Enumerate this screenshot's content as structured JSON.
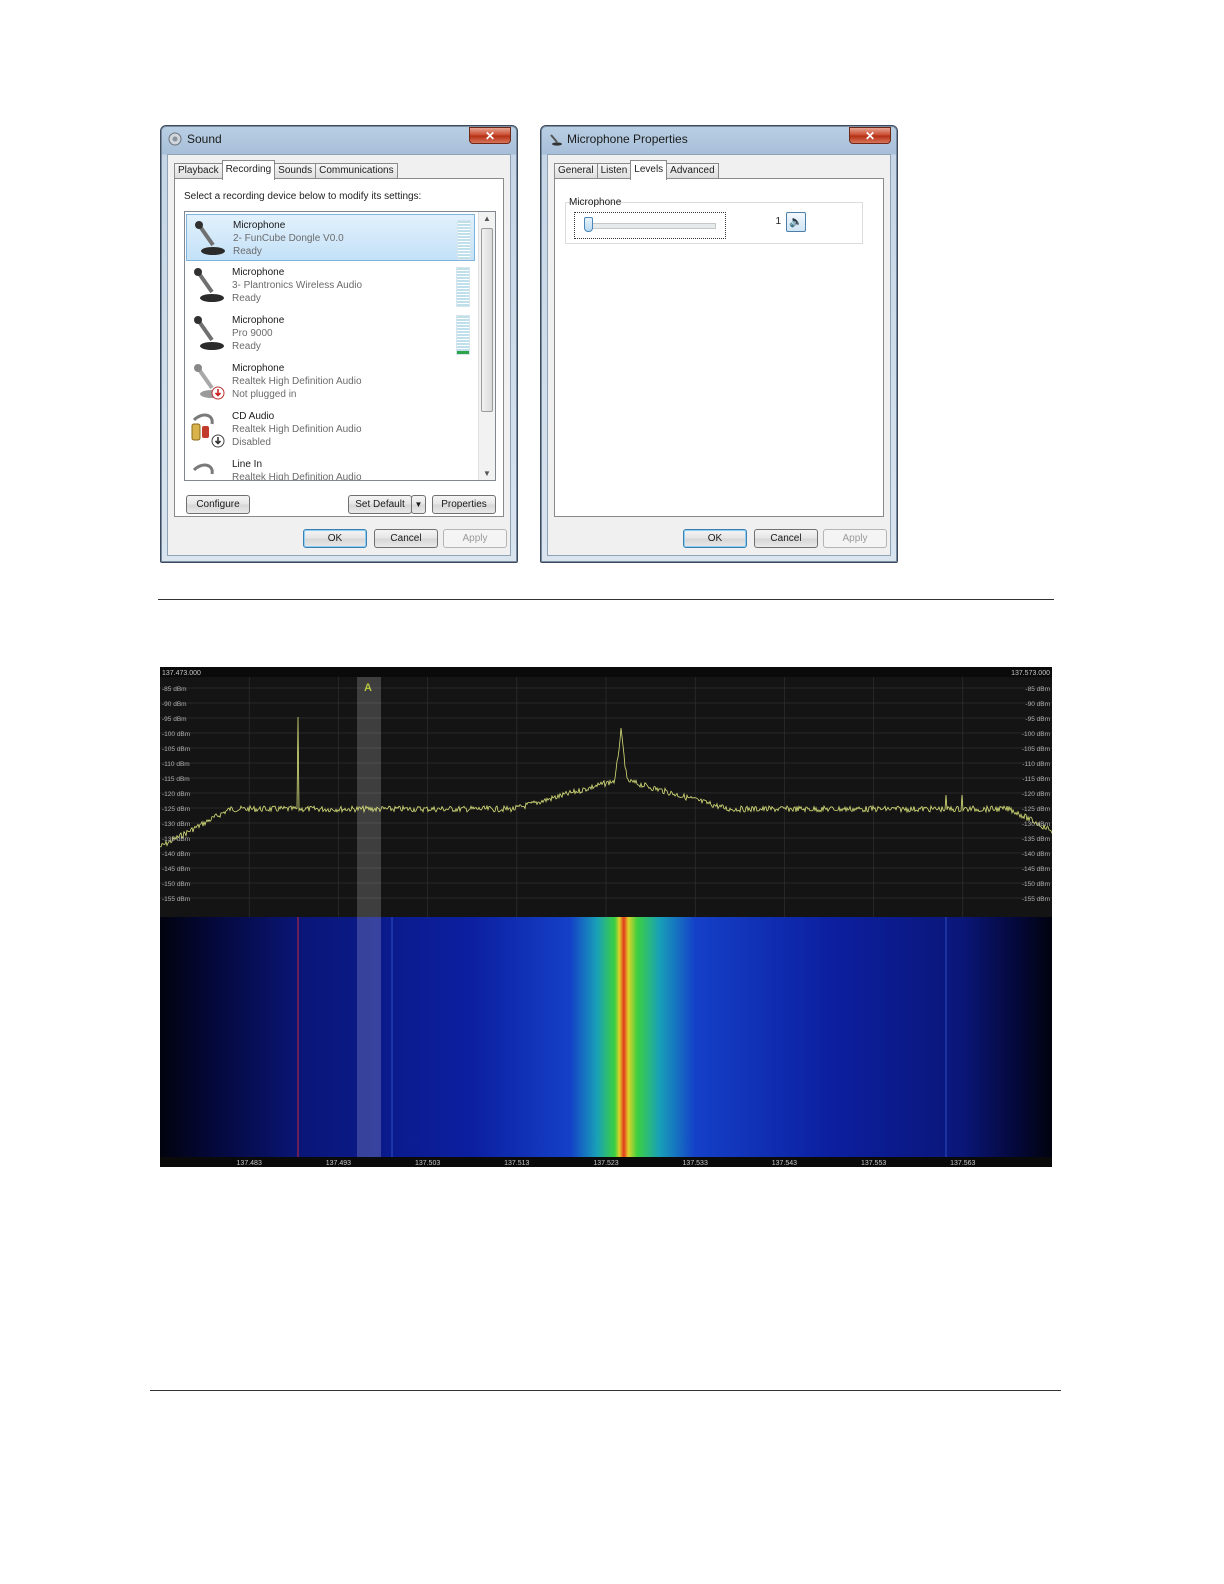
{
  "sound_dialog": {
    "title": "Sound",
    "close": "✕",
    "tabs": [
      "Playback",
      "Recording",
      "Sounds",
      "Communications"
    ],
    "active_tab": "Recording",
    "intro": "Select a recording device below to modify its settings:",
    "devices": [
      {
        "name": "Microphone",
        "sub": "2- FunCube Dongle V0.0",
        "status": "Ready",
        "icon": "microphone-icon",
        "selected": true
      },
      {
        "name": "Microphone",
        "sub": "3- Plantronics Wireless Audio",
        "status": "Ready",
        "icon": "microphone-icon"
      },
      {
        "name": "Microphone",
        "sub": "Pro 9000",
        "status": "Ready",
        "icon": "microphone-icon"
      },
      {
        "name": "Microphone",
        "sub": "Realtek High Definition Audio",
        "status": "Not plugged in",
        "icon": "microphone-unplugged-icon"
      },
      {
        "name": "CD Audio",
        "sub": "Realtek High Definition Audio",
        "status": "Disabled",
        "icon": "cd-audio-icon"
      },
      {
        "name": "Line In",
        "sub": "Realtek High Definition Audio",
        "status": "",
        "icon": "line-in-icon"
      }
    ],
    "configure": "Configure",
    "set_default": "Set Default",
    "properties": "Properties",
    "ok": "OK",
    "cancel": "Cancel",
    "apply": "Apply"
  },
  "mic_properties": {
    "title": "Microphone Properties",
    "close": "✕",
    "tabs": [
      "General",
      "Listen",
      "Levels",
      "Advanced"
    ],
    "active_tab": "Levels",
    "group_label": "Microphone",
    "level_value": "1",
    "level_fraction": 0.01,
    "ok": "OK",
    "cancel": "Cancel",
    "apply": "Apply"
  },
  "spectrum": {
    "freq_left": "137.473.000",
    "freq_right": "137.573.000",
    "marker_label": "A",
    "dbm_labels": [
      "-85 dBm",
      "-90 dBm",
      "-95 dBm",
      "-100 dBm",
      "-105 dBm",
      "-110 dBm",
      "-115 dBm",
      "-120 dBm",
      "-125 dBm",
      "-130 dBm",
      "-135 dBm",
      "-140 dBm",
      "-145 dBm",
      "-150 dBm",
      "-155 dBm"
    ],
    "freq_ticks": [
      "137.483",
      "137.493",
      "137.503",
      "137.513",
      "137.523",
      "137.533",
      "137.543",
      "137.553",
      "137.563"
    ],
    "colors": {
      "trace": "#d8e07a",
      "background": "#000000",
      "waterfall_low": "#0a0f6e",
      "waterfall_high": "#22d24a",
      "carrier": "#e23a1e"
    }
  }
}
